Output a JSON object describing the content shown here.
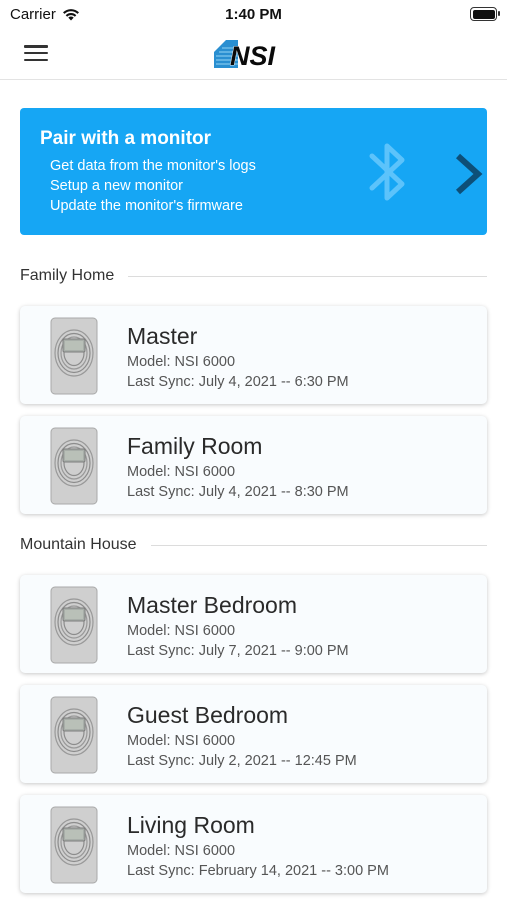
{
  "status_bar": {
    "carrier": "Carrier",
    "time": "1:40 PM"
  },
  "header": {
    "logo_text": "NSI",
    "menu_icon": "hamburger-icon"
  },
  "pair": {
    "title": "Pair with a monitor",
    "lines": [
      "Get data from the monitor's logs",
      "Setup a new monitor",
      "Update the monitor's firmware"
    ],
    "icons": [
      "bluetooth-icon",
      "chevron-right-icon"
    ],
    "color": "#16a6f4"
  },
  "sections": [
    {
      "label": "Family Home",
      "devices": [
        {
          "name": "Master",
          "model": "Model: NSI 6000",
          "sync": "Last Sync: July 4, 2021 -- 6:30 PM"
        },
        {
          "name": "Family Room",
          "model": "Model: NSI 6000",
          "sync": "Last Sync: July 4, 2021 -- 8:30 PM"
        }
      ]
    },
    {
      "label": "Mountain House",
      "devices": [
        {
          "name": "Master Bedroom",
          "model": "Model: NSI 6000",
          "sync": "Last Sync: July 7, 2021 -- 9:00 PM"
        },
        {
          "name": "Guest Bedroom",
          "model": "Model: NSI 6000",
          "sync": "Last Sync: July 2, 2021 -- 12:45 PM"
        },
        {
          "name": "Living Room",
          "model": "Model: NSI 6000",
          "sync": "Last Sync: February 14, 2021 -- 3:00 PM"
        }
      ]
    }
  ]
}
